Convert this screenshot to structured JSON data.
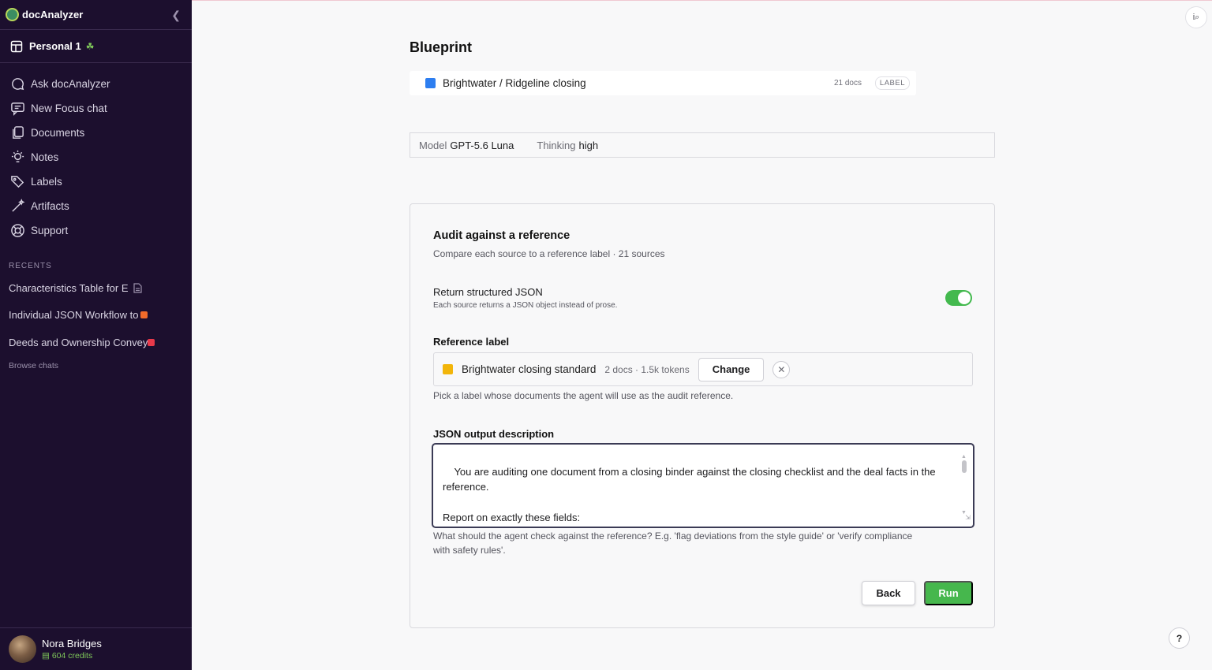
{
  "app": {
    "name": "docAnalyzer",
    "collapse_icon": "chevron-left-icon"
  },
  "workspace": {
    "name": "Personal 1",
    "icon": "layout-grid-icon",
    "badge_icon": "leaf-icon"
  },
  "nav": [
    {
      "label": "Ask docAnalyzer",
      "icon": "chat-bubble-icon"
    },
    {
      "label": "New Focus chat",
      "icon": "chat-plus-icon"
    },
    {
      "label": "Documents",
      "icon": "documents-icon"
    },
    {
      "label": "Notes",
      "icon": "lightbulb-icon"
    },
    {
      "label": "Labels",
      "icon": "tags-icon"
    },
    {
      "label": "Artifacts",
      "icon": "magic-wand-icon"
    },
    {
      "label": "Support",
      "icon": "lifebuoy-icon"
    }
  ],
  "recents": {
    "title": "RECENTS",
    "items": [
      {
        "label": "Characteristics Table for E",
        "marker_icon": "document-icon"
      },
      {
        "label": "Individual JSON Workflow to",
        "marker_color": "#f26b2a"
      },
      {
        "label": "Deeds and Ownership Convey",
        "marker_color": "#e8394a"
      }
    ],
    "browse_label": "Browse chats"
  },
  "user": {
    "name": "Nora Bridges",
    "credits": "604 credits"
  },
  "main": {
    "title": "Blueprint",
    "blueprint": {
      "name": "Brightwater / Ridgeline closing",
      "docs": "21 docs",
      "label": "LABEL",
      "color": "#2d7ef0"
    },
    "model": {
      "model_key": "Model",
      "model_value": "GPT-5.6 Luna",
      "thinking_key": "Thinking",
      "thinking_value": "high"
    },
    "card": {
      "title": "Audit against a reference",
      "subtitle": "Compare each source to a reference label · 21 sources",
      "toggle_title": "Return structured JSON",
      "toggle_subtitle": "Each source returns a JSON object instead of prose.",
      "toggle_on": true,
      "reference_title": "Reference label",
      "reference": {
        "name": "Brightwater closing standard",
        "meta": "2 docs · 1.5k tokens",
        "color": "#f2b50a"
      },
      "change_label": "Change",
      "reference_help": "Pick a label whose documents the agent will use as the audit reference.",
      "json_title": "JSON output description",
      "json_value": "You are auditing one document from a closing binder against the closing checklist and the deal facts in the reference.\n\nReport on exactly these fields:\n- \"document_title\": the title on the face of this document, copied as printed.",
      "json_help": "What should the agent check against the reference? E.g. 'flag deviations from the style guide' or 'verify compliance with safety rules'.",
      "back_label": "Back",
      "run_label": "Run"
    }
  },
  "info_label": "i",
  "help_label": "?",
  "colors": {
    "sidebar_bg": "#1c0f2e",
    "accent_green": "#46b74d"
  }
}
